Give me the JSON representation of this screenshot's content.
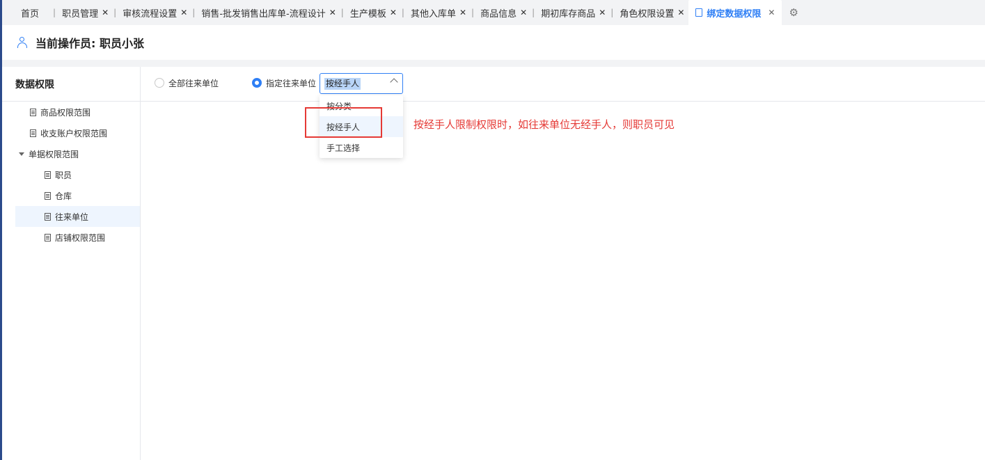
{
  "tabs": [
    {
      "label": "首页",
      "closable": false
    },
    {
      "label": "职员管理",
      "closable": true
    },
    {
      "label": "审核流程设置",
      "closable": true
    },
    {
      "label": "销售-批发销售出库单-流程设计",
      "closable": true
    },
    {
      "label": "生产模板",
      "closable": true
    },
    {
      "label": "其他入库单",
      "closable": true
    },
    {
      "label": "商品信息",
      "closable": true
    },
    {
      "label": "期初库存商品",
      "closable": true
    },
    {
      "label": "角色权限设置",
      "closable": true
    },
    {
      "label": "绑定数据权限",
      "closable": true,
      "active": true
    }
  ],
  "icons": {
    "close": "✕",
    "separator": "|",
    "gear": "⚙"
  },
  "operator": {
    "title": "当前操作员: 职员小张"
  },
  "sidebar": {
    "title": "数据权限",
    "items": [
      {
        "label": "商品权限范围",
        "level": 1
      },
      {
        "label": "收支账户权限范围",
        "level": 1
      },
      {
        "label": "单据权限范围",
        "level": 0,
        "expanded": true
      },
      {
        "label": "职员",
        "level": 2
      },
      {
        "label": "仓库",
        "level": 2
      },
      {
        "label": "往来单位",
        "level": 2,
        "selected": true
      },
      {
        "label": "店铺权限范围",
        "level": 2
      }
    ]
  },
  "toolbar": {
    "radio_all": "全部往来单位",
    "radio_specified": "指定往来单位",
    "select_value": "按经手人"
  },
  "dropdown": {
    "options": [
      "按分类",
      "按经手人",
      "手工选择"
    ],
    "highlighted": "按经手人"
  },
  "annotation": "按经手人限制权限时，如往来单位无经手人，则职员可见",
  "colors": {
    "accent": "#2f7ff5",
    "annotation": "#e53935",
    "selected_bg": "#eef5fe"
  }
}
